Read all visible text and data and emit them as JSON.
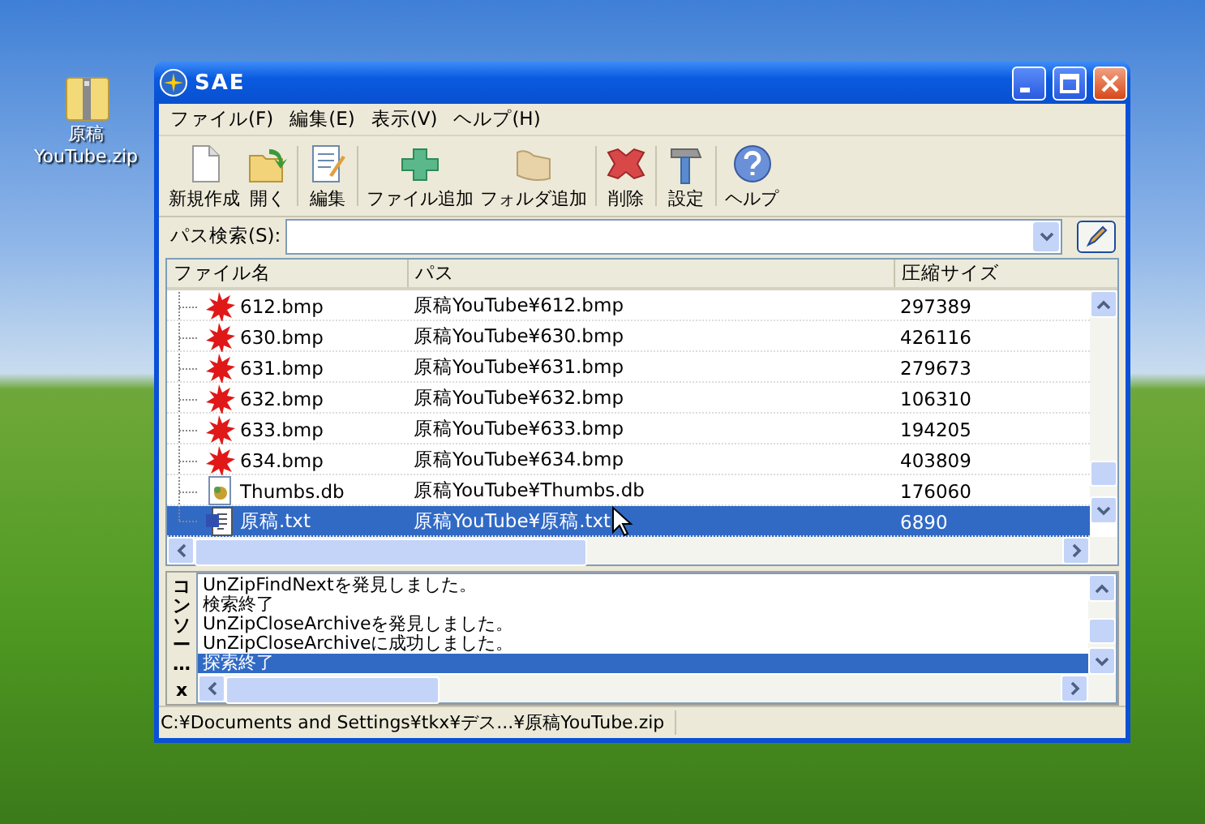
{
  "desktop_icon": {
    "label_line_1": "原稿",
    "label_line_2": "YouTube.zip"
  },
  "window": {
    "title": "SAE"
  },
  "menu": [
    {
      "label": "ファイル(F)"
    },
    {
      "label": "編集(E)"
    },
    {
      "label": "表示(V)"
    },
    {
      "label": "ヘルプ(H)"
    }
  ],
  "toolbar": [
    {
      "kind": "new",
      "label": "新規作成",
      "separator_after": false
    },
    {
      "kind": "open",
      "label": "開く",
      "separator_after": true
    },
    {
      "kind": "edit",
      "label": "編集",
      "separator_after": true
    },
    {
      "kind": "add_file",
      "label": "ファイル追加",
      "separator_after": false
    },
    {
      "kind": "add_folder",
      "label": "フォルダ追加",
      "separator_after": true
    },
    {
      "kind": "delete",
      "label": "削除",
      "separator_after": true
    },
    {
      "kind": "settings",
      "label": "設定",
      "separator_after": true
    },
    {
      "kind": "help",
      "label": "ヘルプ",
      "separator_after": false
    }
  ],
  "path_search": {
    "label": "パス検索(S):"
  },
  "table": {
    "columns": [
      "ファイル名",
      "パス",
      "圧縮サイズ"
    ],
    "rows": [
      {
        "kind": "bmp",
        "name": "612.bmp",
        "path": "原稿YouTube¥612.bmp",
        "size": "297389",
        "selected": false
      },
      {
        "kind": "bmp",
        "name": "630.bmp",
        "path": "原稿YouTube¥630.bmp",
        "size": "426116",
        "selected": false
      },
      {
        "kind": "bmp",
        "name": "631.bmp",
        "path": "原稿YouTube¥631.bmp",
        "size": "279673",
        "selected": false
      },
      {
        "kind": "bmp",
        "name": "632.bmp",
        "path": "原稿YouTube¥632.bmp",
        "size": "106310",
        "selected": false
      },
      {
        "kind": "bmp",
        "name": "633.bmp",
        "path": "原稿YouTube¥633.bmp",
        "size": "194205",
        "selected": false
      },
      {
        "kind": "bmp",
        "name": "634.bmp",
        "path": "原稿YouTube¥634.bmp",
        "size": "403809",
        "selected": false
      },
      {
        "kind": "db",
        "name": "Thumbs.db",
        "path": "原稿YouTube¥Thumbs.db",
        "size": "176060",
        "selected": false
      },
      {
        "kind": "txt",
        "name": "原稿.txt",
        "path": "原稿YouTube¥原稿.txt",
        "size": "6890",
        "selected": true
      }
    ]
  },
  "console": {
    "title": "コンソー…",
    "close": "x",
    "lines": [
      {
        "text": "UnZipFindNextを発見しました。",
        "selected": false
      },
      {
        "text": "検索終了",
        "selected": false
      },
      {
        "text": "UnZipCloseArchiveを発見しました。",
        "selected": false
      },
      {
        "text": "UnZipCloseArchiveに成功しました。",
        "selected": false
      },
      {
        "text": "探索終了",
        "selected": true
      }
    ]
  },
  "status_bar": {
    "text": "C:¥Documents and Settings¥tkx¥デス...¥原稿YouTube.zip"
  }
}
